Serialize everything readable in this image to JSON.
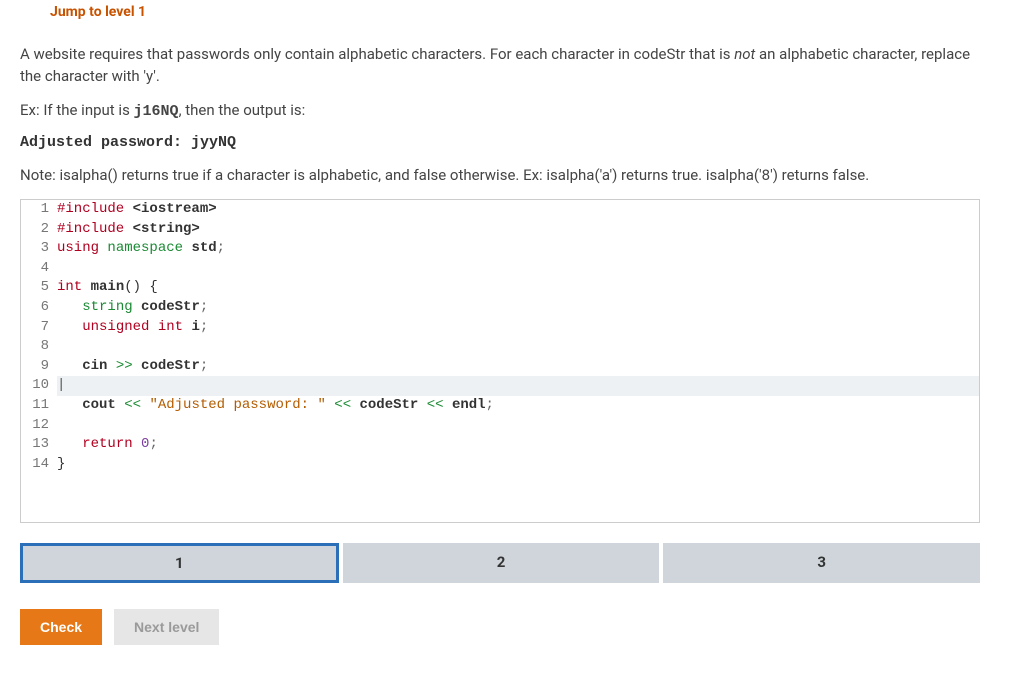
{
  "meta": {
    "id_text": ""
  },
  "jump_link": "Jump to level 1",
  "instructions": {
    "p1_a": "A website requires that passwords only contain alphabetic characters. For each character in codeStr that is ",
    "p1_not": "not",
    "p1_b": " an alphabetic character, replace the character with 'y'.",
    "p2_a": "Ex: If the input is ",
    "p2_code": "j16NQ",
    "p2_b": ", then the output is:",
    "example_output": "Adjusted password: jyyNQ",
    "p3": "Note: isalpha() returns true if a character is alphabetic, and false otherwise. Ex: isalpha('a') returns true. isalpha('8') returns false."
  },
  "code": {
    "lines": [
      {
        "n": "1",
        "tokens": [
          [
            "#include ",
            "pre"
          ],
          [
            "<iostream>",
            "id"
          ]
        ]
      },
      {
        "n": "2",
        "tokens": [
          [
            "#include ",
            "pre"
          ],
          [
            "<string>",
            "id"
          ]
        ]
      },
      {
        "n": "3",
        "tokens": [
          [
            "using ",
            "kw"
          ],
          [
            "namespace ",
            "ns"
          ],
          [
            "std",
            "id"
          ],
          [
            ";",
            "punc"
          ]
        ]
      },
      {
        "n": "4",
        "tokens": [
          [
            "",
            ""
          ]
        ]
      },
      {
        "n": "5",
        "tokens": [
          [
            "int ",
            "kw"
          ],
          [
            "main",
            "id"
          ],
          [
            "() {",
            ""
          ]
        ]
      },
      {
        "n": "6",
        "tokens": [
          [
            "   ",
            ""
          ],
          [
            "string ",
            "ns"
          ],
          [
            "codeStr",
            "id"
          ],
          [
            ";",
            "punc"
          ]
        ]
      },
      {
        "n": "7",
        "tokens": [
          [
            "   ",
            ""
          ],
          [
            "unsigned int ",
            "kw"
          ],
          [
            "i",
            "id"
          ],
          [
            ";",
            "punc"
          ]
        ]
      },
      {
        "n": "8",
        "tokens": [
          [
            "",
            ""
          ]
        ]
      },
      {
        "n": "9",
        "tokens": [
          [
            "   ",
            ""
          ],
          [
            "cin ",
            "id"
          ],
          [
            ">> ",
            "op"
          ],
          [
            "codeStr",
            "id"
          ],
          [
            ";",
            "punc"
          ]
        ]
      },
      {
        "n": "10",
        "tokens": [
          [
            "",
            ""
          ]
        ],
        "cursor": true
      },
      {
        "n": "11",
        "tokens": [
          [
            "   ",
            ""
          ],
          [
            "cout ",
            "id"
          ],
          [
            "<< ",
            "op"
          ],
          [
            "\"Adjusted password: \"",
            "str"
          ],
          [
            " << ",
            "op"
          ],
          [
            "codeStr ",
            "id"
          ],
          [
            "<< ",
            "op"
          ],
          [
            "endl",
            "id"
          ],
          [
            ";",
            "punc"
          ]
        ]
      },
      {
        "n": "12",
        "tokens": [
          [
            "",
            ""
          ]
        ]
      },
      {
        "n": "13",
        "tokens": [
          [
            "   ",
            ""
          ],
          [
            "return ",
            "kw"
          ],
          [
            "0",
            "num"
          ],
          [
            ";",
            "punc"
          ]
        ]
      },
      {
        "n": "14",
        "tokens": [
          [
            "}",
            ""
          ]
        ]
      }
    ]
  },
  "steps": {
    "items": [
      "1",
      "2",
      "3"
    ],
    "active": 0
  },
  "buttons": {
    "check": "Check",
    "next": "Next level"
  }
}
